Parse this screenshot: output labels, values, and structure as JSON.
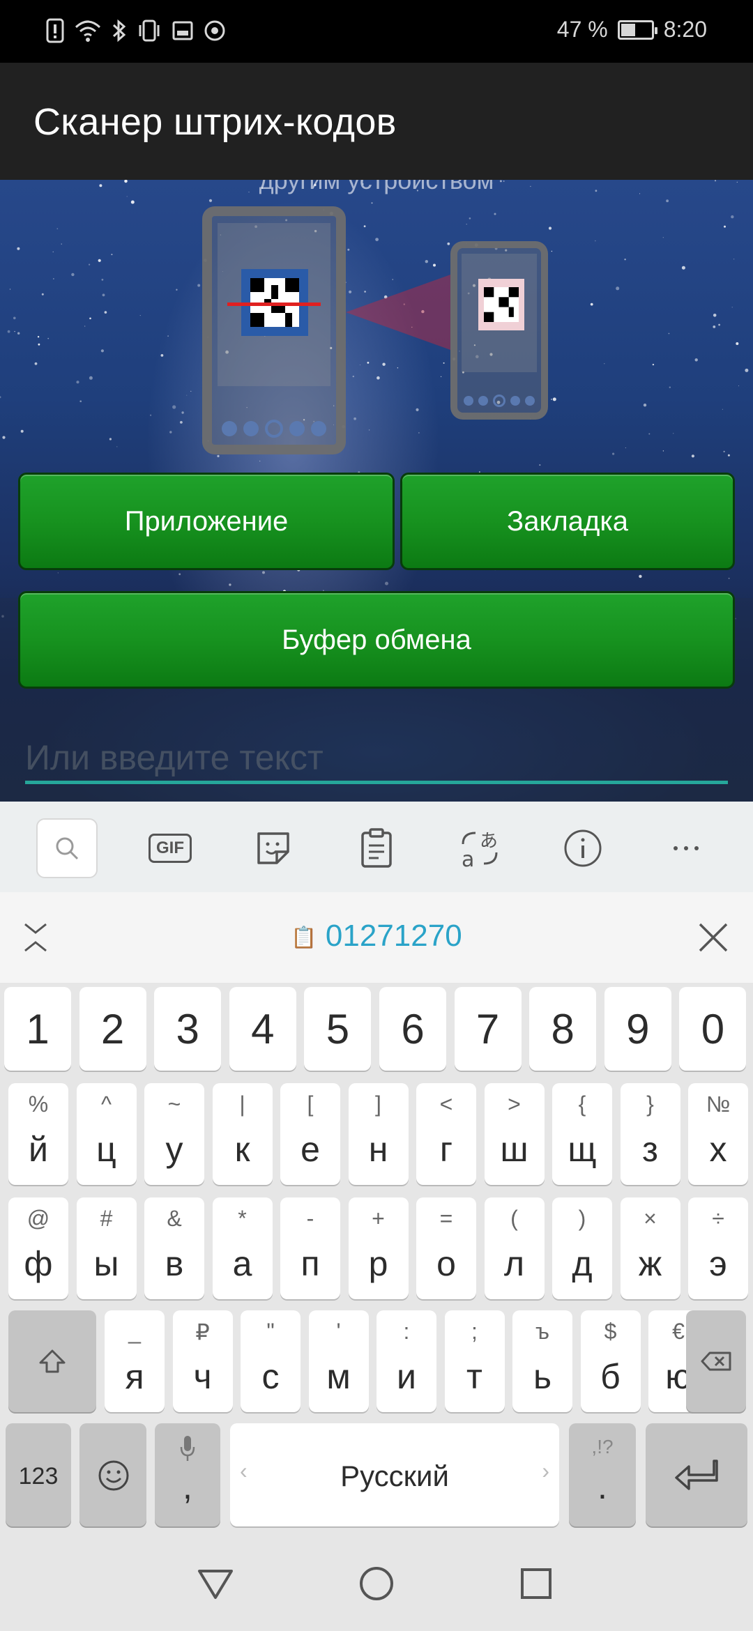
{
  "status_bar": {
    "battery": "47 %",
    "battery_level": 0.47,
    "time": "8:20"
  },
  "app_bar": {
    "title": "Сканер штрих-кодов"
  },
  "content": {
    "partial_text": "другим устройством",
    "buttons": {
      "app": "Приложение",
      "bookmark": "Закладка",
      "clipboard": "Буфер обмена"
    },
    "input": {
      "placeholder": "Или введите текст",
      "value": ""
    }
  },
  "keyboard": {
    "toolbar": {
      "gif_label": "GIF"
    },
    "clipboard_suggestion": "01271270",
    "row_numbers": [
      "1",
      "2",
      "3",
      "4",
      "5",
      "6",
      "7",
      "8",
      "9",
      "0"
    ],
    "row1": [
      {
        "k": "й",
        "s": "%"
      },
      {
        "k": "ц",
        "s": "^"
      },
      {
        "k": "у",
        "s": "~"
      },
      {
        "k": "к",
        "s": "|"
      },
      {
        "k": "е",
        "s": "["
      },
      {
        "k": "н",
        "s": "]"
      },
      {
        "k": "г",
        "s": "<"
      },
      {
        "k": "ш",
        "s": ">"
      },
      {
        "k": "щ",
        "s": "{"
      },
      {
        "k": "з",
        "s": "}"
      },
      {
        "k": "х",
        "s": "№"
      }
    ],
    "row2": [
      {
        "k": "ф",
        "s": "@"
      },
      {
        "k": "ы",
        "s": "#"
      },
      {
        "k": "в",
        "s": "&"
      },
      {
        "k": "а",
        "s": "*"
      },
      {
        "k": "п",
        "s": "-"
      },
      {
        "k": "р",
        "s": "+"
      },
      {
        "k": "о",
        "s": "="
      },
      {
        "k": "л",
        "s": "("
      },
      {
        "k": "д",
        "s": ")"
      },
      {
        "k": "ж",
        "s": "×"
      },
      {
        "k": "э",
        "s": "÷"
      }
    ],
    "row3": [
      {
        "k": "я",
        "s": "_"
      },
      {
        "k": "ч",
        "s": "₽"
      },
      {
        "k": "с",
        "s": "\""
      },
      {
        "k": "м",
        "s": "'"
      },
      {
        "k": "и",
        "s": ":"
      },
      {
        "k": "т",
        "s": ";"
      },
      {
        "k": "ь",
        "s": "ъ"
      },
      {
        "k": "б",
        "s": "$"
      },
      {
        "k": "ю",
        "s": "€"
      }
    ],
    "bottom": {
      "numbers_label": "123",
      "comma": ",",
      "space_label": "Русский",
      "period": ".",
      "period_sub": ",!?"
    }
  }
}
